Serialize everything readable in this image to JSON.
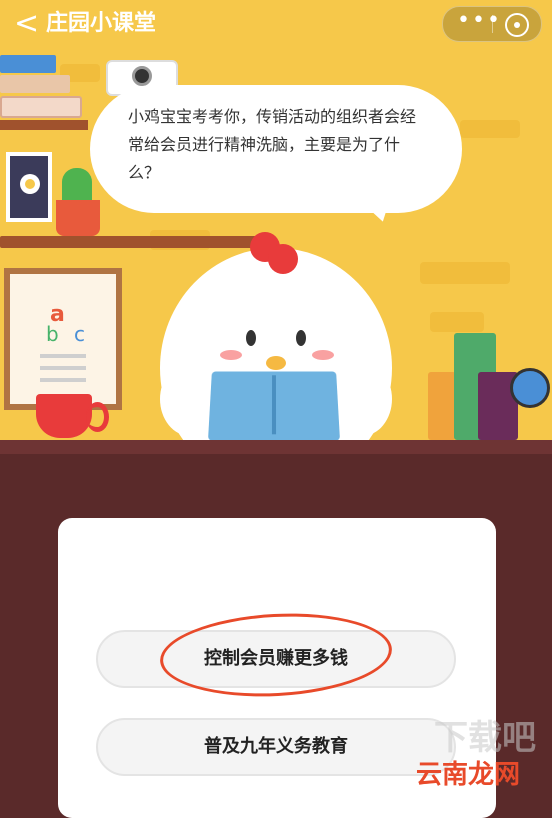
{
  "header": {
    "back_glyph": "<",
    "title": "庄园小课堂",
    "more_glyph": "•••"
  },
  "question": {
    "text": "小鸡宝宝考考你，传销活动的组织者会经常给会员进行精神洗脑，主要是为了什么？"
  },
  "chalkboard": {
    "letter_a": "a",
    "letter_b": "b",
    "letter_c": "c"
  },
  "options": [
    {
      "label": "控制会员赚更多钱",
      "highlighted": true
    },
    {
      "label": "普及九年义务教育",
      "highlighted": false
    }
  ],
  "watermark": {
    "text": "云南龙网",
    "ghost_text": "下载吧"
  },
  "colors": {
    "scene_bg": "#f6c84a",
    "desk": "#5a2a2a",
    "highlight_circle": "#e84a2a"
  }
}
